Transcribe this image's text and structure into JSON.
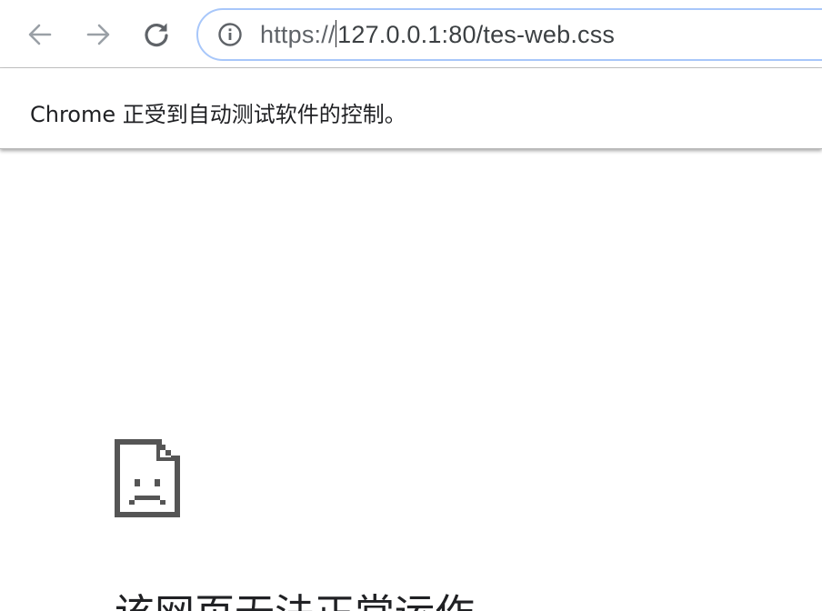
{
  "toolbar": {
    "back_icon": "arrow-left-icon",
    "forward_icon": "arrow-right-icon",
    "reload_icon": "reload-icon",
    "address_bar": {
      "site_info_icon": "info-circle-icon",
      "url_scheme": "https://",
      "url_host_path": "127.0.0.1:80/tes-web.css"
    }
  },
  "infobar": {
    "message": "Chrome 正受到自动测试软件的控制。"
  },
  "error_page": {
    "icon": "sad-page-icon",
    "heading": "该网页无法正常运作"
  },
  "colors": {
    "omnibox_border": "#a8c7fa",
    "icon_gray": "#5f6368",
    "disabled_icon": "#9aa0a6",
    "text": "#202124"
  }
}
